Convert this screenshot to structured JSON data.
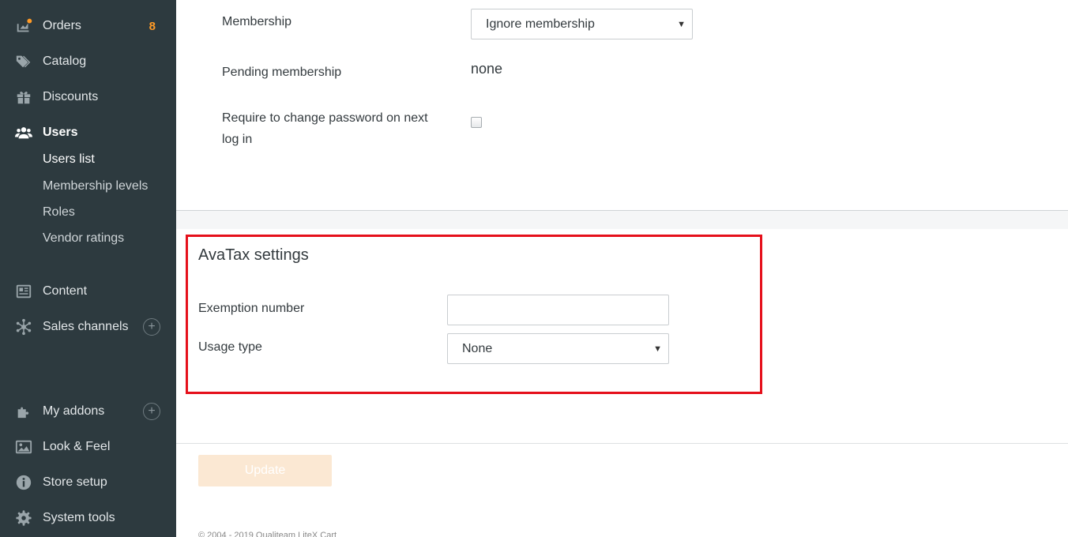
{
  "sidebar": {
    "items": [
      {
        "label": "Orders",
        "icon": "orders-icon",
        "badge": "8"
      },
      {
        "label": "Catalog",
        "icon": "tag-icon"
      },
      {
        "label": "Discounts",
        "icon": "gift-icon"
      },
      {
        "label": "Users",
        "icon": "users-icon"
      },
      {
        "label": "Content",
        "icon": "newspaper-icon"
      },
      {
        "label": "Sales channels",
        "icon": "network-icon"
      },
      {
        "label": "My addons",
        "icon": "puzzle-icon"
      },
      {
        "label": "Look & Feel",
        "icon": "image-icon"
      },
      {
        "label": "Store setup",
        "icon": "info-icon"
      },
      {
        "label": "System tools",
        "icon": "gear-icon"
      }
    ],
    "users_subitems": [
      "Users list",
      "Membership levels",
      "Roles",
      "Vendor ratings"
    ],
    "accent_color": "#ff9a26"
  },
  "form": {
    "membership_label": "Membership",
    "membership_value": "Ignore membership",
    "pending_label": "Pending membership",
    "pending_value": "none",
    "require_label_line1": "Require to change password on next",
    "require_label_line2": "log in",
    "require_checked": false
  },
  "avatax": {
    "title": "AvaTax settings",
    "exemption_label": "Exemption number",
    "exemption_value": "",
    "usage_label": "Usage type",
    "usage_value": "None",
    "highlight_color": "#e5101b"
  },
  "footer": {
    "update_label": "Update",
    "copyright": "© 2004 - 2019 Qualiteam LiteX Cart"
  }
}
